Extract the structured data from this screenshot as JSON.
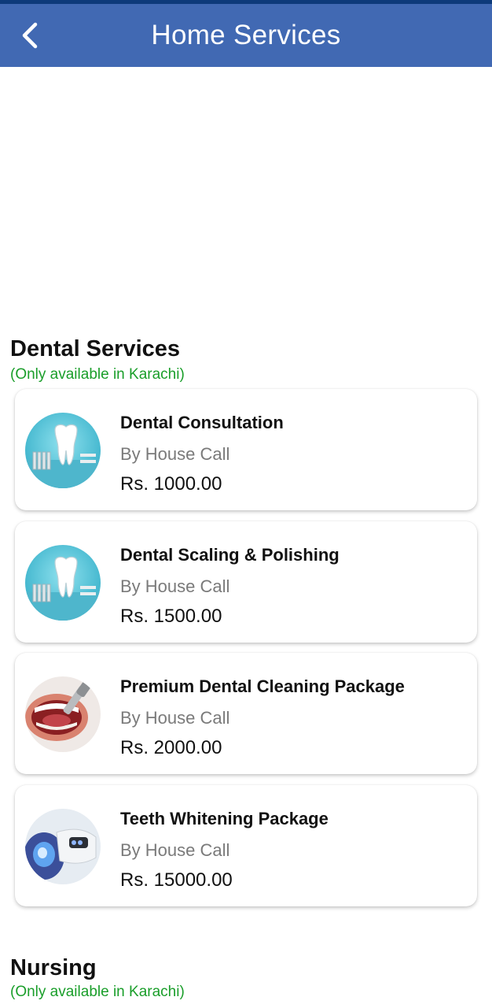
{
  "appbar": {
    "title": "Home Services",
    "back_icon": "chevron-left-icon"
  },
  "sections": [
    {
      "title": "Dental Services",
      "subtitle": "(Only available in Karachi)",
      "services": [
        {
          "name": "Dental Consultation",
          "type": "By House Call",
          "price": "Rs. 1000.00",
          "image": "tooth-icon"
        },
        {
          "name": "Dental Scaling & Polishing",
          "type": "By House Call",
          "price": "Rs. 1500.00",
          "image": "tooth-icon"
        },
        {
          "name": "Premium Dental Cleaning Package",
          "type": "By House Call",
          "price": "Rs. 2000.00",
          "image": "mouth-cleaning-icon"
        },
        {
          "name": "Teeth Whitening Package",
          "type": "By House Call",
          "price": "Rs. 15000.00",
          "image": "teeth-whitening-icon"
        }
      ]
    },
    {
      "title": "Nursing",
      "subtitle": "(Only available in Karachi)"
    }
  ],
  "colors": {
    "appbar": "#4169b3",
    "subtitle": "#1a9e2a",
    "muted": "#7a7a7a"
  }
}
